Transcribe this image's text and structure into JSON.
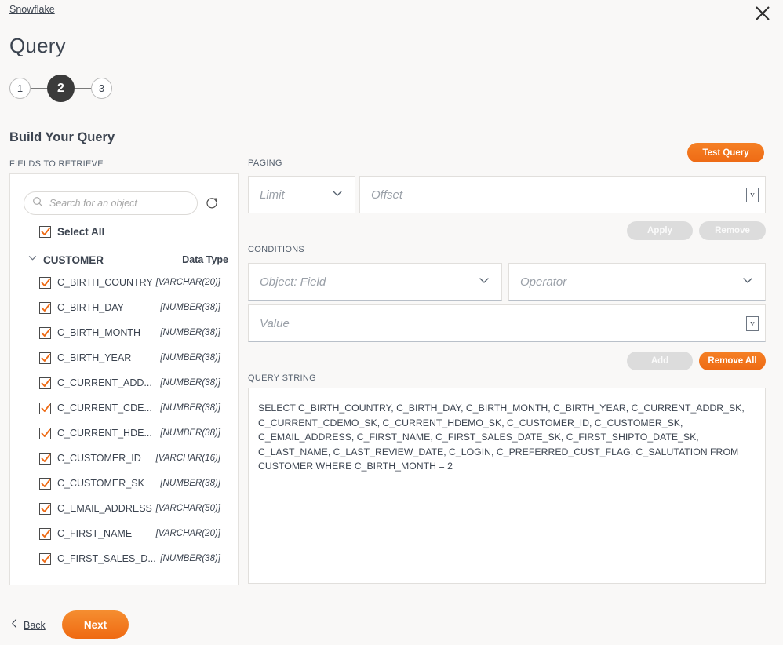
{
  "header": {
    "breadcrumb": "Snowflake",
    "title": "Query",
    "close_icon": "close-icon"
  },
  "steps": [
    {
      "label": "1",
      "active": false
    },
    {
      "label": "2",
      "active": true
    },
    {
      "label": "3",
      "active": false
    }
  ],
  "section": {
    "build_heading": "Build Your Query"
  },
  "left_panel": {
    "label": "FIELDS TO RETRIEVE",
    "search": {
      "placeholder": "Search for an object",
      "value": "",
      "icon": "search-icon"
    },
    "refresh_icon": "refresh-icon",
    "select_all": {
      "label": "Select All",
      "checked": true
    },
    "object": {
      "name": "CUSTOMER",
      "expanded": true,
      "data_type_header": "Data Type"
    },
    "fields": [
      {
        "name": "C_BIRTH_COUNTRY",
        "type": "[VARCHAR(20)]",
        "checked": true
      },
      {
        "name": "C_BIRTH_DAY",
        "type": "[NUMBER(38)]",
        "checked": true
      },
      {
        "name": "C_BIRTH_MONTH",
        "type": "[NUMBER(38)]",
        "checked": true
      },
      {
        "name": "C_BIRTH_YEAR",
        "type": "[NUMBER(38)]",
        "checked": true
      },
      {
        "name": "C_CURRENT_ADD...",
        "type": "[NUMBER(38)]",
        "checked": true
      },
      {
        "name": "C_CURRENT_CDE...",
        "type": "[NUMBER(38)]",
        "checked": true
      },
      {
        "name": "C_CURRENT_HDE...",
        "type": "[NUMBER(38)]",
        "checked": true
      },
      {
        "name": "C_CUSTOMER_ID",
        "type": "[VARCHAR(16)]",
        "checked": true
      },
      {
        "name": "C_CUSTOMER_SK",
        "type": "[NUMBER(38)]",
        "checked": true
      },
      {
        "name": "C_EMAIL_ADDRESS",
        "type": "[VARCHAR(50)]",
        "checked": true
      },
      {
        "name": "C_FIRST_NAME",
        "type": "[VARCHAR(20)]",
        "checked": true
      },
      {
        "name": "C_FIRST_SALES_D...",
        "type": "[NUMBER(38)]",
        "checked": true
      }
    ]
  },
  "right_panel": {
    "test_query_label": "Test Query",
    "paging": {
      "label": "PAGING",
      "limit_placeholder": "Limit",
      "limit_value": "",
      "offset_placeholder": "Offset",
      "offset_value": "",
      "variable_glyph": "v",
      "apply_label": "Apply",
      "remove_label": "Remove"
    },
    "conditions": {
      "label": "CONDITIONS",
      "objectfield_placeholder": "Object: Field",
      "objectfield_value": "",
      "operator_placeholder": "Operator",
      "operator_value": "",
      "value_placeholder": "Value",
      "value_value": "",
      "variable_glyph": "v",
      "add_label": "Add",
      "remove_all_label": "Remove All"
    },
    "query_string": {
      "label": "QUERY STRING",
      "text": "SELECT C_BIRTH_COUNTRY, C_BIRTH_DAY, C_BIRTH_MONTH, C_BIRTH_YEAR, C_CURRENT_ADDR_SK, C_CURRENT_CDEMO_SK, C_CURRENT_HDEMO_SK, C_CUSTOMER_ID, C_CUSTOMER_SK, C_EMAIL_ADDRESS, C_FIRST_NAME, C_FIRST_SALES_DATE_SK, C_FIRST_SHIPTO_DATE_SK, C_LAST_NAME, C_LAST_REVIEW_DATE, C_LOGIN, C_PREFERRED_CUST_FLAG, C_SALUTATION FROM CUSTOMER WHERE C_BIRTH_MONTH = 2"
    }
  },
  "footer": {
    "back_label": "Back",
    "back_icon": "chevron-left-icon",
    "next_label": "Next"
  },
  "colors": {
    "accent": "#ee6a14",
    "text": "#3c4450",
    "background": "#f9f8f7",
    "disabled": "#dcdcdc",
    "step_active": "#3b3b3b"
  }
}
